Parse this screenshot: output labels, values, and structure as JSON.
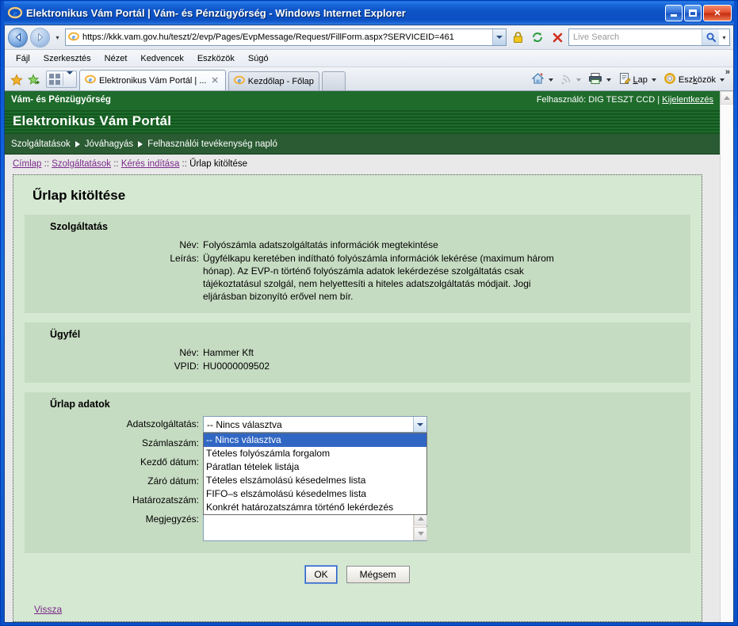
{
  "window": {
    "title": "Elektronikus Vám Portál | Vám- és Pénzügyőrség - Windows Internet Explorer",
    "minimize_label": "Minimize",
    "maximize_label": "Maximize",
    "close_label": "Close"
  },
  "browser": {
    "url": "https://kkk.vam.gov.hu/teszt/2/evp/Pages/EvpMessage/Request/FillForm.aspx?SERVICEID=461",
    "search_placeholder": "Live Search",
    "menus": [
      "Fájl",
      "Szerkesztés",
      "Nézet",
      "Kedvencek",
      "Eszközök",
      "Súgó"
    ],
    "tabs": [
      {
        "label": "Elektronikus Vám Portál | ...",
        "active": true,
        "closable": true
      },
      {
        "label": "Kezdőlap - Főlap",
        "active": false,
        "closable": false
      }
    ],
    "command_bar": [
      {
        "name": "home-icon",
        "label": ""
      },
      {
        "name": "rss-icon",
        "label": ""
      },
      {
        "name": "print-icon",
        "label": ""
      },
      {
        "name": "page-icon",
        "label": "Lap"
      },
      {
        "name": "tools-icon",
        "label": "Eszközök"
      }
    ],
    "more_chevron": "»"
  },
  "portal": {
    "org_name": "Vám- és Pénzügyőrség",
    "user_prefix": "Felhasználó:",
    "user_name": "DIG TESZT CCD",
    "separator": "|",
    "logout_label": "Kijelentkezés",
    "site_title": "Elektronikus Vám Portál",
    "nav": [
      "Szolgáltatások",
      "Jóváhagyás",
      "Felhasználói tevékenység napló"
    ],
    "breadcrumb": [
      {
        "label": "Címlap",
        "link": true
      },
      {
        "label": "Szolgáltatások",
        "link": true
      },
      {
        "label": "Kérés indítása",
        "link": true
      },
      {
        "label": "Űrlap kitöltése",
        "link": false
      }
    ],
    "breadcrumb_separator": "::"
  },
  "form": {
    "page_title": "Űrlap kitöltése",
    "service": {
      "heading": "Szolgáltatás",
      "name_label": "Név:",
      "name_value": "Folyószámla adatszolgáltatás információk megtekintése",
      "desc_label": "Leírás:",
      "desc_value": "Ügyfélkapu keretében indítható folyószámla információk lekérése (maximum három hónap). Az EVP-n történő folyószámla adatok lekérdezése szolgáltatás csak tájékoztatásul szolgál, nem helyettesíti a hiteles adatszolgáltatás módjait. Jogi eljárásban bizonyító erővel nem bír."
    },
    "client": {
      "heading": "Ügyfél",
      "name_label": "Név:",
      "name_value": "Hammer Kft",
      "vpid_label": "VPID:",
      "vpid_value": "HU0000009502"
    },
    "data": {
      "heading": "Űrlap adatok",
      "fields": [
        {
          "label": "Adatszolgáltatás:",
          "type": "select",
          "value": "-- Nincs választva"
        },
        {
          "label": "Számlaszám:",
          "type": "text",
          "value": ""
        },
        {
          "label": "Kezdő dátum:",
          "type": "text",
          "value": ""
        },
        {
          "label": "Záró dátum:",
          "type": "text",
          "value": ""
        },
        {
          "label": "Határozatszám:",
          "type": "text",
          "value": ""
        },
        {
          "label": "Megjegyzés:",
          "type": "textarea",
          "value": ""
        }
      ],
      "dropdown_open": true,
      "dropdown_options": [
        "-- Nincs választva",
        "Tételes folyószámla forgalom",
        "Páratlan tételek listája",
        "Tételes elszámolású késedelmes lista",
        "FIFO–s elszámolású késedelmes lista",
        "Konkrét határozatszámra történő lekérdezés"
      ],
      "dropdown_selected_index": 0
    },
    "buttons": {
      "ok": "OK",
      "cancel": "Mégsem"
    },
    "back_link": "Vissza"
  },
  "colors": {
    "gov_green": "#1f6b2c",
    "nav_green": "#2a5b32",
    "panel_green": "#d5e8d2",
    "section_green": "#c6dcc2",
    "link_purple": "#7a2a8a",
    "select_highlight": "#3167c4"
  }
}
